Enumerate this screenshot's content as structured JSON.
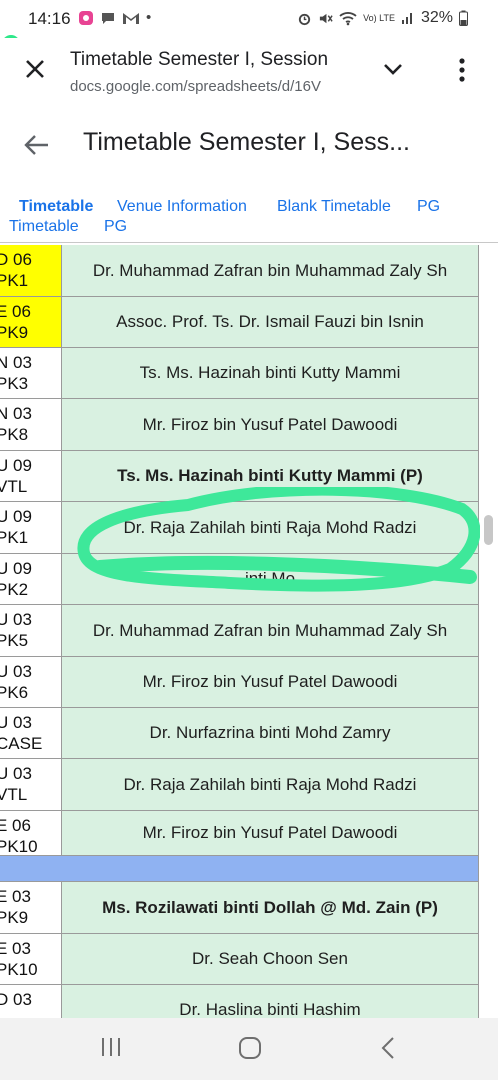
{
  "status_bar": {
    "time": "14:16",
    "battery": "32%",
    "network": "Vo) LTE"
  },
  "chrome_bar": {
    "page_title": "Timetable Semester I, Session",
    "url": "docs.google.com/spreadsheets/d/16V"
  },
  "app_bar": {
    "title": "Timetable Semester I, Sess..."
  },
  "sheet_tabs": [
    {
      "line1": "Timetable",
      "line2": "Timetable",
      "active": true
    },
    {
      "line1": "Venue Information",
      "line2": "PG",
      "active": false
    },
    {
      "line1": "Blank Timetable",
      "line2": "",
      "active": false
    },
    {
      "line1": "PG",
      "line2": "",
      "active": false
    }
  ],
  "rows": [
    {
      "code1": "D 06",
      "code2": "PK1",
      "lecturer": "Dr. Muhammad Zafran bin Muhammad Zaly Sh",
      "bold": false,
      "code_bg": "yellow"
    },
    {
      "code1": "E 06",
      "code2": "PK9",
      "lecturer": "Assoc. Prof. Ts. Dr. Ismail Fauzi bin Isnin",
      "bold": false,
      "code_bg": "yellow"
    },
    {
      "code1": "N 03",
      "code2": "PK3",
      "lecturer": "Ts. Ms. Hazinah binti Kutty Mammi",
      "bold": false,
      "code_bg": "white"
    },
    {
      "code1": "N 03",
      "code2": "PK8",
      "lecturer": "Mr. Firoz bin Yusuf Patel Dawoodi",
      "bold": false,
      "code_bg": "white"
    },
    {
      "code1": "U 09",
      "code2": "VTL",
      "lecturer": "Ts. Ms. Hazinah binti Kutty Mammi (P)",
      "bold": true,
      "code_bg": "white"
    },
    {
      "code1": "U 09",
      "code2": "PK1",
      "lecturer": "Dr. Raja Zahilah binti Raja Mohd Radzi",
      "bold": false,
      "code_bg": "white"
    },
    {
      "code1": "U 09",
      "code2": "PK2",
      "lecturer": "...inti Mo...",
      "bold": false,
      "code_bg": "white"
    },
    {
      "code1": "U 03",
      "code2": "PK5",
      "lecturer": "Dr. Muhammad Zafran bin Muhammad Zaly Sh",
      "bold": false,
      "code_bg": "white"
    },
    {
      "code1": "U 03",
      "code2": "PK6",
      "lecturer": "Mr. Firoz bin Yusuf Patel Dawoodi",
      "bold": false,
      "code_bg": "white"
    },
    {
      "code1": "U 03",
      "code2": "CASE",
      "lecturer": "Dr. Nurfazrina binti Mohd Zamry",
      "bold": false,
      "code_bg": "white"
    },
    {
      "code1": "U 03",
      "code2": "VTL",
      "lecturer": "Dr. Raja Zahilah binti Raja Mohd Radzi",
      "bold": false,
      "code_bg": "white"
    },
    {
      "code1": "E 06",
      "code2": "PK10",
      "lecturer": "Mr. Firoz bin Yusuf Patel Dawoodi",
      "bold": false,
      "code_bg": "white"
    }
  ],
  "rows_after_separator": [
    {
      "code1": "E 03",
      "code2": "PK9",
      "lecturer": "Ms. Rozilawati binti Dollah @ Md. Zain (P)",
      "bold": true,
      "code_bg": "white"
    },
    {
      "code1": "E 03",
      "code2": "PK10",
      "lecturer": "Dr. Seah Choon Sen",
      "bold": false,
      "code_bg": "white"
    },
    {
      "code1": "D 03",
      "code2": "",
      "lecturer": "Dr. Haslina binti Hashim",
      "bold": false,
      "code_bg": "white"
    }
  ],
  "colors": {
    "lecturer_cell": "#d9f1e1",
    "highlight_code": "#ffff00",
    "separator_row": "#8fb2f2",
    "annotation_stroke": "#3ee89a",
    "link_blue": "#1a73e8"
  }
}
